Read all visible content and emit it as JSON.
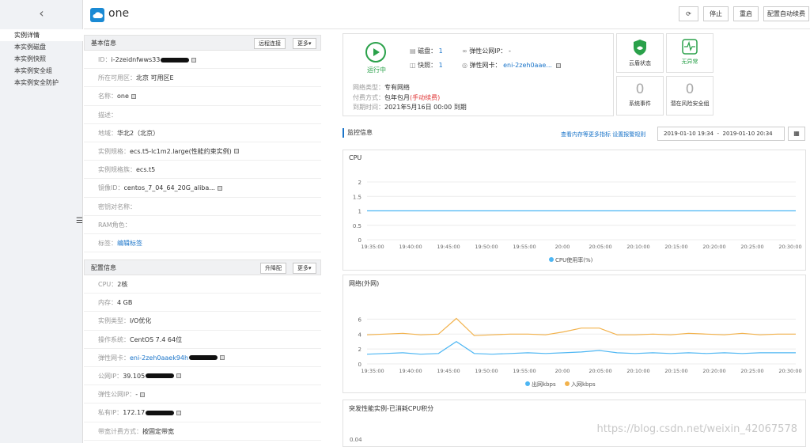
{
  "sidebar": {
    "items": [
      "实例详情",
      "本实例磁盘",
      "本实例快照",
      "本实例安全组",
      "本实例安全防护"
    ]
  },
  "header": {
    "title": "one",
    "buttons": [
      "停止",
      "重启",
      "配置自动续费"
    ]
  },
  "basic": {
    "title": "基本信息",
    "btn1": "远程连接",
    "btn2": "更多▾",
    "rows": [
      {
        "label": "ID：",
        "value": "i-2zeidnfwws33"
      },
      {
        "label": "所在可用区：",
        "value": "北京 可用区E"
      },
      {
        "label": "名称：",
        "value": "one"
      },
      {
        "label": "描述：",
        "value": ""
      },
      {
        "label": "地域：",
        "value": "华北2（北京）"
      },
      {
        "label": "实例规格：",
        "value": "ecs.t5-lc1m2.large",
        "extra": "(性能约束实例)"
      },
      {
        "label": "实例规格族：",
        "value": "ecs.t5"
      },
      {
        "label": "镜像ID：",
        "value": "centos_7_04_64_20G_aliba..."
      },
      {
        "label": "密钥对名称：",
        "value": ""
      },
      {
        "label": "RAM角色：",
        "value": ""
      },
      {
        "label": "标签：",
        "value": "编辑标签"
      }
    ]
  },
  "config": {
    "title": "配置信息",
    "btn1": "升降配",
    "btn2": "更多▾",
    "rows": [
      {
        "label": "CPU：",
        "value": "2核"
      },
      {
        "label": "内存：",
        "value": "4 GB"
      },
      {
        "label": "实例类型：",
        "value": "I/O优化"
      },
      {
        "label": "操作系统：",
        "value": "CentOS 7.4 64位"
      },
      {
        "label": "弹性网卡：",
        "value": "eni-2zeh0aaek94h"
      },
      {
        "label": "公网IP：",
        "value": "39.105"
      },
      {
        "label": "弹性公网IP：",
        "value": "-"
      },
      {
        "label": "私有IP：",
        "value": "172.17"
      },
      {
        "label": "带宽计费方式：",
        "value": "按固定带宽"
      }
    ]
  },
  "status": {
    "running": "运行中",
    "disk_label": "磁盘：",
    "disk_val": "1",
    "snap_label": "快照：",
    "snap_val": "1",
    "eip_label": "弹性公网IP：",
    "eip_val": "-",
    "eni_label": "弹性网卡：",
    "eni_val": "eni-2zeh0aae...",
    "net_type_label": "网络类型：",
    "net_type": "专有网络",
    "pay_label": "付费方式：",
    "pay": "包年包月",
    "pay_note": "(手动续费)",
    "expire_label": "到期时间：",
    "expire": "2021年5月16日 00:00 到期"
  },
  "security": {
    "shield": "云盾状态",
    "health": "无异常",
    "events_count": "0",
    "events": "系统事件",
    "risk_count": "0",
    "risk": "潜在风险安全组"
  },
  "monitor": {
    "title": "监控信息",
    "link1": "查看内存等更多指标",
    "link2": "设置报警规则",
    "range_start": "2019-01-10 19:34",
    "range_sep": "-",
    "range_end": "2019-01-10 20:34"
  },
  "chart_data": [
    {
      "type": "line",
      "title": "CPU",
      "x": [
        "19:35:00",
        "19:40:00",
        "19:45:00",
        "19:50:00",
        "19:55:00",
        "20:00",
        "20:05:00",
        "20:10:00",
        "20:15:00",
        "20:20:00",
        "20:25:00",
        "20:30:00"
      ],
      "yticks": [
        "0",
        "0.5",
        "1",
        "1.5",
        "2"
      ],
      "ylim": [
        0,
        2
      ],
      "series": [
        {
          "name": "CPU使用率(%)",
          "color": "#4db6f3",
          "values": [
            1,
            1,
            1,
            1,
            1,
            1,
            1,
            1,
            1,
            1,
            1,
            1,
            1,
            1,
            1,
            1,
            1,
            1,
            1,
            1,
            1,
            1,
            1,
            1,
            1
          ]
        }
      ]
    },
    {
      "type": "line",
      "title": "网络(外网)",
      "x": [
        "19:35:00",
        "19:40:00",
        "19:45:00",
        "19:50:00",
        "19:55:00",
        "20:00",
        "20:05:00",
        "20:10:00",
        "20:15:00",
        "20:20:00",
        "20:25:00",
        "20:30:00"
      ],
      "yticks": [
        "0",
        "2",
        "4",
        "6"
      ],
      "ylim": [
        0,
        7
      ],
      "series": [
        {
          "name": "出网kbps",
          "color": "#4db6f3",
          "values": [
            1.3,
            1.4,
            1.5,
            1.3,
            1.4,
            3.0,
            1.4,
            1.3,
            1.4,
            1.5,
            1.4,
            1.5,
            1.6,
            1.8,
            1.5,
            1.4,
            1.5,
            1.4,
            1.5,
            1.4,
            1.5,
            1.4,
            1.5,
            1.5,
            1.5
          ]
        },
        {
          "name": "入网kbps",
          "color": "#f2b24c",
          "values": [
            3.9,
            4.0,
            4.1,
            3.9,
            4.0,
            6.1,
            3.8,
            3.9,
            4.0,
            4.0,
            3.9,
            4.3,
            4.8,
            4.8,
            3.9,
            3.9,
            4.0,
            3.9,
            4.1,
            4.0,
            3.9,
            4.1,
            3.9,
            4.0,
            4.0
          ]
        }
      ]
    }
  ],
  "burst": {
    "title": "突发性能实例-已消耗CPU积分",
    "ytick": "0.04"
  },
  "watermark": "https://blog.csdn.net/weixin_42067578"
}
